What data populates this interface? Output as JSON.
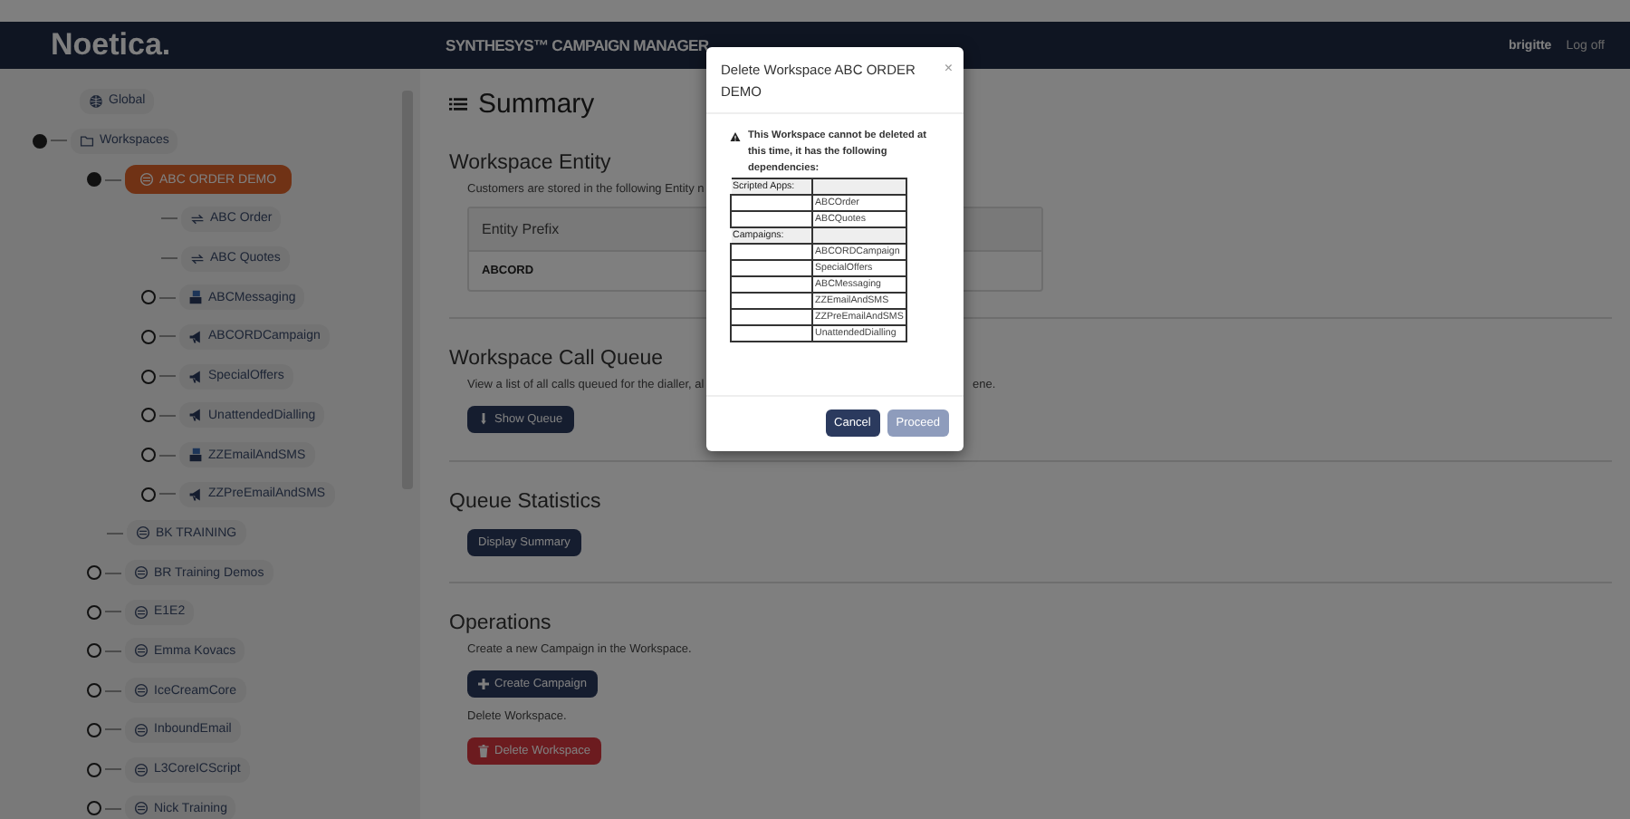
{
  "header": {
    "logo": "Noetica.",
    "title": "SYNTHESYS™ CAMPAIGN MANAGER",
    "user": "brigitte",
    "logoff": "Log off"
  },
  "tree": [
    {
      "label": "Global",
      "kind": "global",
      "selected": false
    },
    {
      "label": "Workspaces",
      "kind": "folder",
      "selected": false,
      "expanded": true,
      "children": [
        {
          "label": "ABC ORDER DEMO",
          "kind": "workspace",
          "selected": true,
          "expanded": true,
          "children": [
            {
              "label": "ABC Order",
              "kind": "app",
              "selected": false
            },
            {
              "label": "ABC Quotes",
              "kind": "app",
              "selected": false
            },
            {
              "label": "ABCMessaging",
              "kind": "messaging",
              "selected": false,
              "expanded": false
            },
            {
              "label": "ABCORDCampaign",
              "kind": "campaign",
              "selected": false,
              "expanded": false
            },
            {
              "label": "SpecialOffers",
              "kind": "campaign",
              "selected": false,
              "expanded": false
            },
            {
              "label": "UnattendedDialling",
              "kind": "campaign",
              "selected": false,
              "expanded": false
            },
            {
              "label": "ZZEmailAndSMS",
              "kind": "messaging",
              "selected": false,
              "expanded": false
            },
            {
              "label": "ZZPreEmailAndSMS",
              "kind": "campaign",
              "selected": false,
              "expanded": false
            }
          ]
        },
        {
          "label": "BK TRAINING",
          "kind": "workspace",
          "selected": false
        },
        {
          "label": "BR Training Demos",
          "kind": "workspace",
          "selected": false,
          "expanded": false
        },
        {
          "label": "E1E2",
          "kind": "workspace",
          "selected": false,
          "expanded": false
        },
        {
          "label": "Emma Kovacs",
          "kind": "workspace",
          "selected": false,
          "expanded": false
        },
        {
          "label": "IceCreamCore",
          "kind": "workspace",
          "selected": false,
          "expanded": false
        },
        {
          "label": "InboundEmail",
          "kind": "workspace",
          "selected": false,
          "expanded": false
        },
        {
          "label": "L3CoreICScript",
          "kind": "workspace",
          "selected": false,
          "expanded": false
        },
        {
          "label": "Nick Training",
          "kind": "workspace",
          "selected": false,
          "expanded": false
        }
      ]
    }
  ],
  "page_title": "Summary",
  "entity": {
    "title": "Workspace Entity",
    "description": "Customers are stored in the following Entity n",
    "column": "Entity Prefix",
    "value": "ABCORD"
  },
  "call_queue": {
    "title": "Workspace Call Queue",
    "description_parts": [
      "View a list of all calls queued for the dialler, al",
      "ene."
    ],
    "button": "Show Queue"
  },
  "queue_stats": {
    "title": "Queue Statistics",
    "button": "Display Summary"
  },
  "operations": {
    "title": "Operations",
    "create_text": "Create a new Campaign in the Workspace.",
    "create_button": "Create Campaign",
    "delete_text": "Delete Workspace.",
    "delete_button": "Delete Workspace"
  },
  "modal": {
    "title": "Delete Workspace ABC ORDER DEMO",
    "close": "×",
    "warning": "This Workspace cannot be deleted at this time, it has the following dependencies:",
    "groups": [
      {
        "label": "Scripted Apps:",
        "items": [
          "ABCOrder",
          "ABCQuotes"
        ]
      },
      {
        "label": "Campaigns:",
        "items": [
          "ABCORDCampaign",
          "SpecialOffers",
          "ABCMessaging",
          "ZZEmailAndSMS",
          "ZZPreEmailAndSMS",
          "UnattendedDialling"
        ]
      }
    ],
    "buttons": [
      {
        "label": "Cancel",
        "disabled": false
      },
      {
        "label": "Proceed",
        "disabled": true
      }
    ]
  }
}
